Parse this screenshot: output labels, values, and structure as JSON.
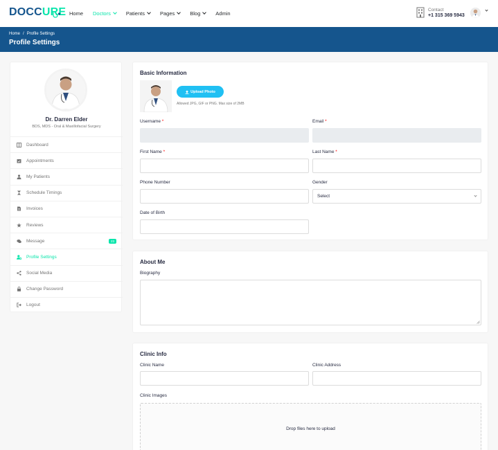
{
  "header": {
    "logo_prefix": "DOCC",
    "logo_suffix": "URE",
    "nav": [
      {
        "label": "Home",
        "dropdown": false,
        "active": false
      },
      {
        "label": "Doctors",
        "dropdown": true,
        "active": true
      },
      {
        "label": "Patients",
        "dropdown": true,
        "active": false
      },
      {
        "label": "Pages",
        "dropdown": true,
        "active": false
      },
      {
        "label": "Blog",
        "dropdown": true,
        "active": false
      },
      {
        "label": "Admin",
        "dropdown": false,
        "active": false
      }
    ],
    "contact_label": "Contact",
    "contact_number": "+1 315 369 5943"
  },
  "breadcrumb": {
    "items": [
      "Home",
      "/",
      "Profile Settings"
    ],
    "title": "Profile Settings"
  },
  "sidebar": {
    "doctor_name": "Dr. Darren Elder",
    "specialty": "BDS, MDS - Oral & Maxillofacial Surgery",
    "menu": [
      {
        "label": "Dashboard",
        "icon": "columns-icon"
      },
      {
        "label": "Appointments",
        "icon": "calendar-check-icon"
      },
      {
        "label": "My Patients",
        "icon": "user-injured-icon"
      },
      {
        "label": "Schedule Timings",
        "icon": "hourglass-icon"
      },
      {
        "label": "Invoices",
        "icon": "file-invoice-icon"
      },
      {
        "label": "Reviews",
        "icon": "star-icon"
      },
      {
        "label": "Message",
        "icon": "comments-icon",
        "badge": "23"
      },
      {
        "label": "Profile Settings",
        "icon": "user-cog-icon",
        "active": true
      },
      {
        "label": "Social Media",
        "icon": "share-alt-icon"
      },
      {
        "label": "Change Password",
        "icon": "lock-icon"
      },
      {
        "label": "Logout",
        "icon": "sign-out-icon"
      }
    ]
  },
  "basic_info": {
    "title": "Basic Information",
    "upload_label": "Upload Photo",
    "upload_note": "Allowed JPG, GIF or PNG. Max size of 2MB",
    "username_label": "Username",
    "email_label": "Email",
    "first_name_label": "First Name",
    "last_name_label": "Last Name",
    "phone_label": "Phone Number",
    "gender_label": "Gender",
    "gender_value": "Select",
    "dob_label": "Date of Birth",
    "required_mark": "*",
    "username_value": "",
    "email_value": "",
    "first_name_value": "",
    "last_name_value": "",
    "phone_value": "",
    "dob_value": ""
  },
  "about": {
    "title": "About Me",
    "biography_label": "Biography",
    "biography_value": ""
  },
  "clinic": {
    "title": "Clinic Info",
    "name_label": "Clinic Name",
    "address_label": "Clinic Address",
    "images_label": "Clinic Images",
    "name_value": "",
    "address_value": "",
    "dropzone_text": "Drop files here to upload"
  },
  "colors": {
    "brand_dark": "#15558d",
    "accent": "#09e5ab",
    "upload_button": "#20c0f3"
  }
}
